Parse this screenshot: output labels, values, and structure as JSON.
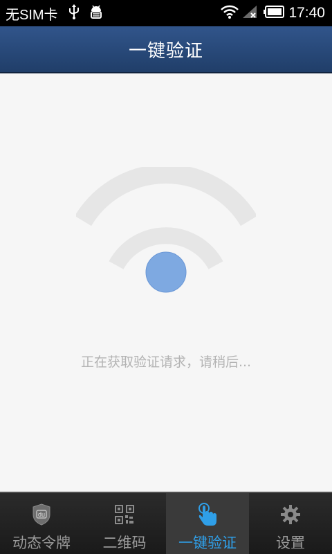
{
  "status_bar": {
    "carrier": "无SIM卡",
    "time": "17:40",
    "icons": [
      "usb-icon",
      "android-debug-icon",
      "wifi-icon",
      "no-signal-icon",
      "battery-icon"
    ]
  },
  "header": {
    "title": "一键验证"
  },
  "main": {
    "graphic": "wifi-signal-icon",
    "status_message": "正在获取验证请求，请稍后..."
  },
  "tabs": [
    {
      "label": "动态令牌",
      "icon": "shield-du-icon",
      "active": false
    },
    {
      "label": "二维码",
      "icon": "qr-code-icon",
      "active": false
    },
    {
      "label": "一键验证",
      "icon": "tap-hand-icon",
      "active": true
    },
    {
      "label": "设置",
      "icon": "gear-icon",
      "active": false
    }
  ],
  "colors": {
    "header_bg": "#2a4a79",
    "active_tab_text": "#2f9fe8",
    "signal_dot": "#7ea9e1",
    "signal_arc": "#e6e6e6"
  }
}
